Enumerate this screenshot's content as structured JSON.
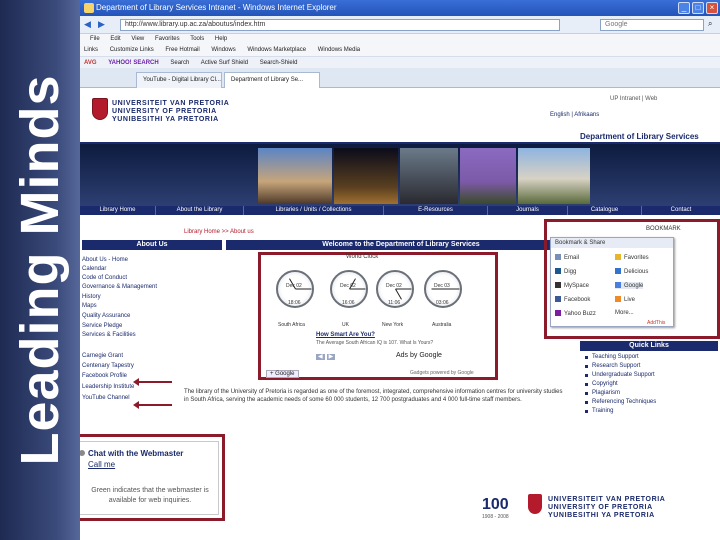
{
  "banner": {
    "text": "Leading Minds"
  },
  "browser": {
    "title": "Department of Library Services Intranet - Windows Internet Explorer",
    "address": "http://www.library.up.ac.za/aboutus/index.htm",
    "search_placeholder": "Google",
    "menu": [
      "File",
      "Edit",
      "View",
      "Favorites",
      "Tools",
      "Help"
    ],
    "links": [
      "Links",
      "Customize Links",
      "Free Hotmail",
      "Windows",
      "Windows Marketplace",
      "Windows Media"
    ],
    "toolbar": [
      "AVG",
      "YAHOO! SEARCH",
      "Search",
      "Active Surf Shield",
      "Search-Shield"
    ],
    "tabs": [
      "YouTube - Digital Library Cl...",
      "Department of Library Se..."
    ]
  },
  "page": {
    "logo_lines": [
      "UNIVERSITEIT VAN PRETORIA",
      "UNIVERSITY OF PRETORIA",
      "YUNIBESITHI YA PRETORIA"
    ],
    "lang": "English | Afrikaans",
    "top_icons": "UP Intranet  |  Web",
    "dept_title": "Department of Library Services",
    "nav": [
      "Library Home",
      "About the Library",
      "Libraries / Units / Collections",
      "E-Resources",
      "Journals",
      "Catalogue",
      "Contact"
    ],
    "breadcrumb": "Library Home >> About us",
    "about_head": "About Us",
    "side_links": [
      "About Us - Home",
      "Calendar",
      "Code of Conduct",
      "Governance & Management",
      "History",
      "Maps",
      "Quality Assurance",
      "Service Pledge",
      "Services & Facilities"
    ],
    "side_links2": [
      "Carnegie Grant",
      "Centenary Tapestry",
      "Facebook Profile",
      "Leadership Institute",
      "YouTube Channel"
    ],
    "welcome_head": "Welcome to the Department of Library Services",
    "world_clock": "World Clock",
    "clocks": [
      {
        "city": "South Africa",
        "date": "Dec 02",
        "time": "18:06"
      },
      {
        "city": "UK",
        "date": "Dec 02",
        "time": "16:06"
      },
      {
        "city": "New York",
        "date": "Dec 02",
        "time": "11:06"
      },
      {
        "city": "Australia",
        "date": "Dec 03",
        "time": "03:06"
      }
    ],
    "smart_q": "How Smart Are You?",
    "smart_sub": "The Average South African IQ is 107. What Is Yours?",
    "ads_by": "Ads by Google",
    "google_btn": "+ Google",
    "powered": "Gadgets powered by Google",
    "intro": "The library of the University of Pretoria is regarded as one of the foremost, integrated, comprehensive information centres for university studies in South Africa, serving the academic needs of some 60 000 students, 12 700 postgraduates and 4 000 full-time staff members.",
    "bookmark": {
      "button": "BOOKMARK",
      "head": "Bookmark & Share",
      "items": [
        "Email",
        "Favorites",
        "Digg",
        "Delicious",
        "MySpace",
        "Google",
        "Facebook",
        "Live",
        "Yahoo Buzz",
        "More..."
      ],
      "addthis": "AddThis"
    },
    "quick_head": "Quick Links",
    "quick_links": [
      "Teaching Support",
      "Research Support",
      "Undergraduate Support",
      "Copyright",
      "Plagiarism",
      "Referencing Techniques",
      "Training"
    ],
    "chat": {
      "title": "Chat with the Webmaster",
      "link": "Call me",
      "note": "Green indicates that the webmaster is available for web inquiries."
    },
    "footer": {
      "hundred": "100",
      "years": "1908 - 2008",
      "name_lines": [
        "UNIVERSITEIT VAN PRETORIA",
        "UNIVERSITY OF PRETORIA",
        "YUNIBESITHI YA PRETORIA"
      ]
    }
  },
  "colors": {
    "banner": "#2a3868",
    "navy": "#1a2a6c",
    "highlight_box": "#8b1a2a",
    "ie_title": "#2354b8"
  }
}
